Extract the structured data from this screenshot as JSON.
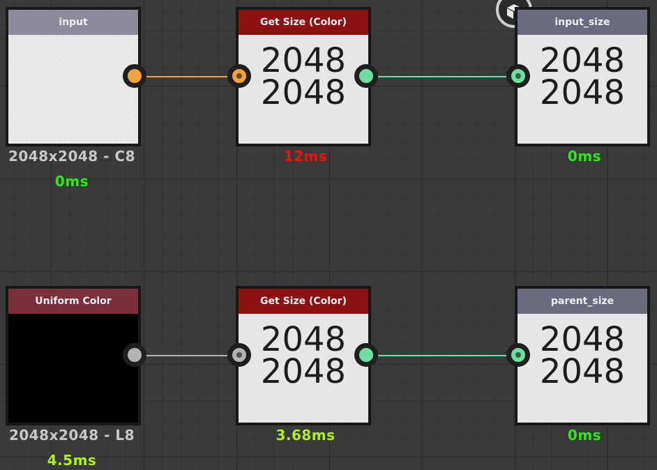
{
  "colors": {
    "orange_port": "#f0a23c",
    "green_port": "#6fdca0",
    "grey_port": "#b3b3b3",
    "header_grey": "#8b8b9c",
    "header_red": "#8c1111",
    "header_maroon": "#7a2f3d",
    "time_green": "#2ee81a",
    "time_red": "#ee1111",
    "time_yellowgreen": "#aef022",
    "info_text": "#c8c8c8"
  },
  "icons": {
    "badge": "cube-icon"
  },
  "nodes": {
    "input": {
      "title": "input",
      "info": "2048x2048 - C8",
      "time": "0ms"
    },
    "get_size_top": {
      "title": "Get Size (Color)",
      "line1": "2048",
      "line2": "2048",
      "time": "12ms"
    },
    "input_size": {
      "title": "input_size",
      "line1": "2048",
      "line2": "2048",
      "time": "0ms"
    },
    "uniform_color": {
      "title": "Uniform Color",
      "info": "2048x2048 - L8",
      "time": "4.5ms"
    },
    "get_size_bottom": {
      "title": "Get Size (Color)",
      "line1": "2048",
      "line2": "2048",
      "time": "3.68ms"
    },
    "parent_size": {
      "title": "parent_size",
      "line1": "2048",
      "line2": "2048",
      "time": "0ms"
    }
  }
}
